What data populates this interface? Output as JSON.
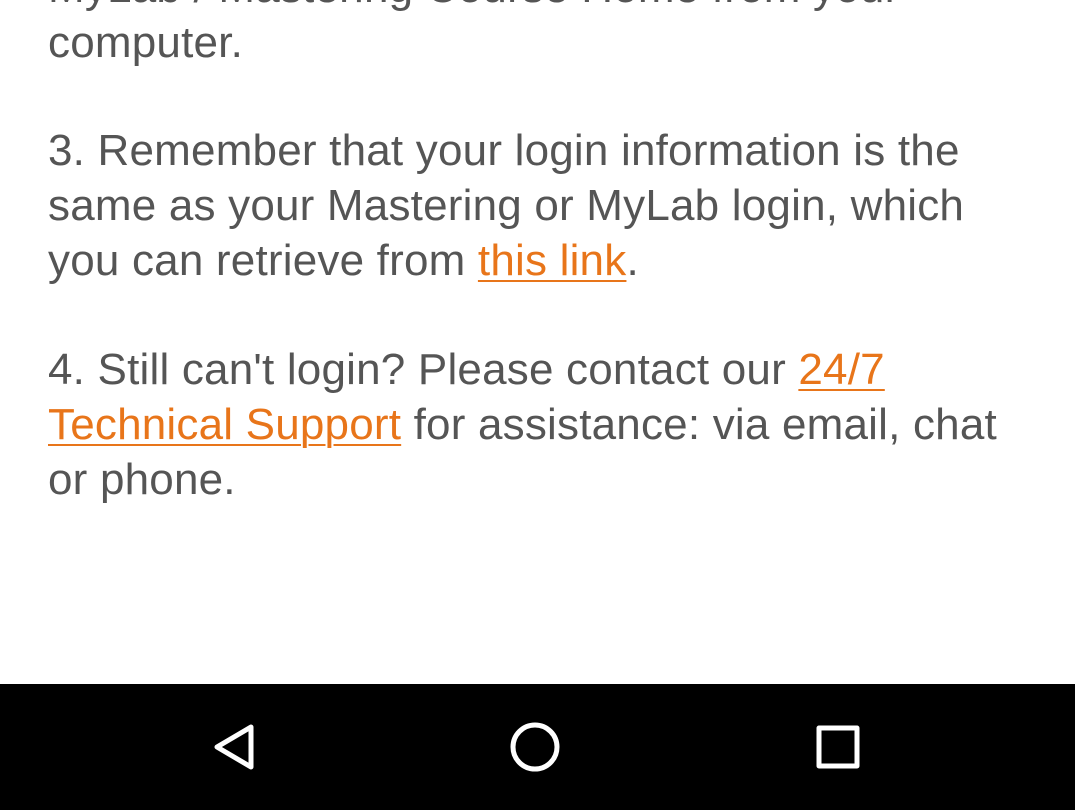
{
  "instructions": {
    "step2_tail_line1": "MyLab / Mastering Course Home from your",
    "step2_tail_line2": "computer.",
    "step3_text": "3. Remember that your login information is the same as your Mastering or MyLab login, which you can retrieve from ",
    "step3_link": "this link",
    "step3_end": ".",
    "step4_text": "4. Still can't login? Please contact our ",
    "step4_link": "24/7 Technical Support",
    "step4_end": " for assistance: via email, chat or phone."
  },
  "colors": {
    "text": "#555555",
    "link": "#e8751a",
    "navbar": "#000000"
  },
  "navbar": {
    "buttons": [
      {
        "icon": "back-triangle-icon"
      },
      {
        "icon": "home-circle-icon"
      },
      {
        "icon": "recents-square-icon"
      }
    ]
  }
}
